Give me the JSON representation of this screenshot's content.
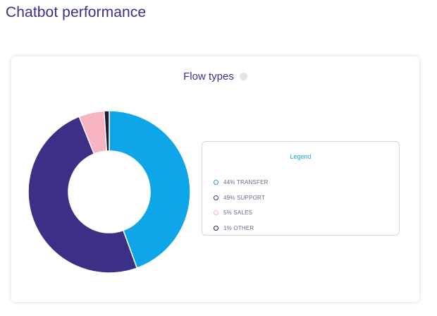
{
  "page": {
    "title": "Chatbot performance"
  },
  "card": {
    "title": "Flow types",
    "info_icon": "info-icon"
  },
  "legend": {
    "title": "Legend",
    "items": [
      {
        "label": "44% TRANSFER",
        "color": "#0ea5e9"
      },
      {
        "label": "49% SUPPORT",
        "color": "#3b2f86"
      },
      {
        "label": "5% SALES",
        "color": "#f7b3c2"
      },
      {
        "label": "1% OTHER",
        "color": "#1f1b3a"
      }
    ]
  },
  "chart_data": {
    "type": "pie",
    "categories": [
      "TRANSFER",
      "SUPPORT",
      "SALES",
      "OTHER"
    ],
    "values": [
      44,
      49,
      5,
      1
    ],
    "unit": "%",
    "colors": [
      "#0ea5e9",
      "#3b2f86",
      "#f7b3c2",
      "#1f1b3a"
    ]
  }
}
